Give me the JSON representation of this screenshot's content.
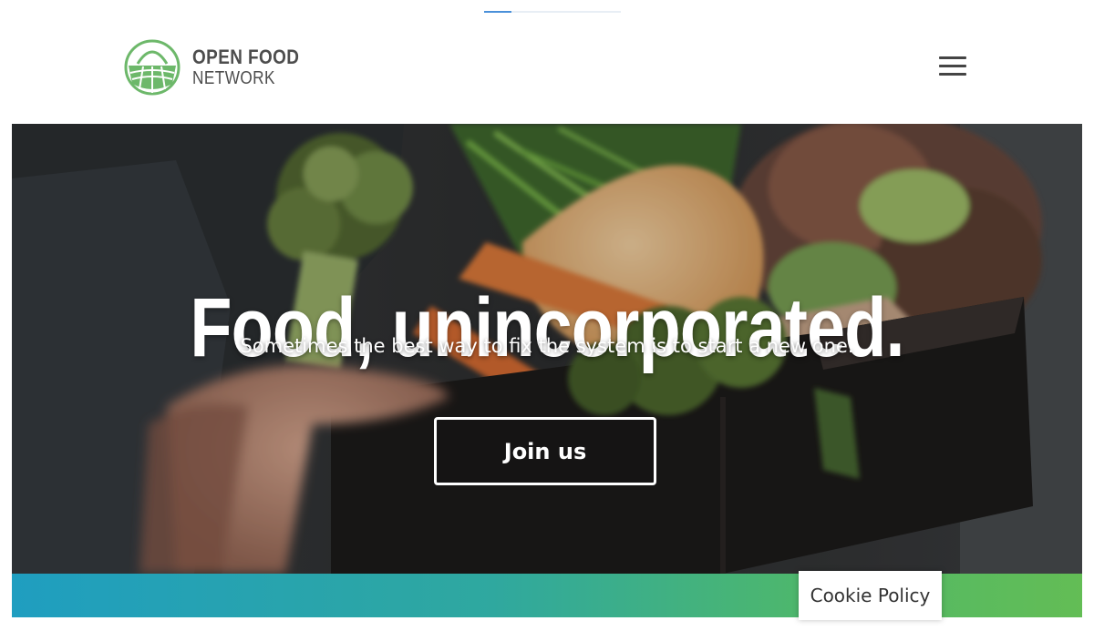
{
  "brand": {
    "name_line1": "OPEN FOOD",
    "name_line2": "NETWORK",
    "logo_icon": "basket-logo-icon",
    "logo_color": "#6db86a"
  },
  "header": {
    "menu_icon": "hamburger-menu-icon",
    "loading_progress": 0.2
  },
  "hero": {
    "title": "Food, unincorporated.",
    "subtitle": "Sometimes the best way to fix the system is to start a new one.",
    "cta_label": "Join us",
    "image": "hands-holding-box-of-vegetables"
  },
  "footer_band": {
    "gradient_start": "#1f9ec0",
    "gradient_end": "#63bd55"
  },
  "cookie": {
    "label": "Cookie Policy"
  }
}
